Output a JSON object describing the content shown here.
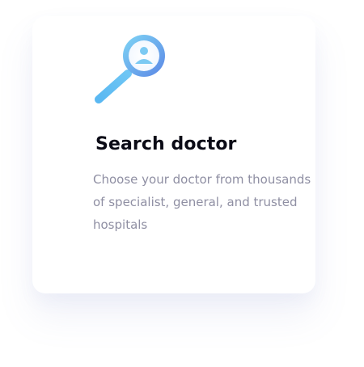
{
  "feature_card": {
    "icon": "doctor-search-icon",
    "title": "Search doctor",
    "description": "Choose your doctor from thousands of specialist, general, and trusted hospitals"
  },
  "colors": {
    "icon_gradient_start": "#7fd6f5",
    "icon_gradient_end": "#5b86e5",
    "title": "#0b0b16",
    "description": "#8f8fa3"
  }
}
